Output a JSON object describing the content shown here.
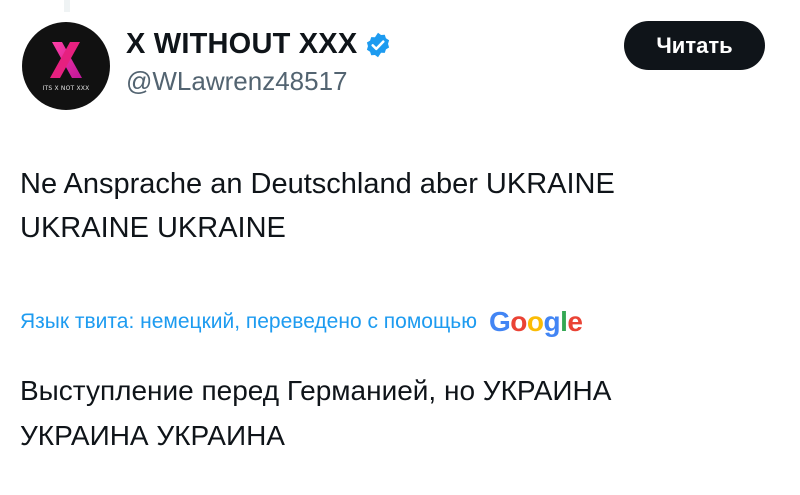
{
  "author": {
    "avatar_caption": "ITS X NOT XXX",
    "display_name": "X WITHOUT XXX",
    "handle": "@WLawrenz48517",
    "verified_icon": "verified-badge-icon"
  },
  "follow_button": {
    "label": "Читать"
  },
  "tweet": {
    "text_line1": "Ne Ansprache an Deutschland aber UKRAINE",
    "text_line2": "UKRAINE UKRAINE"
  },
  "translation": {
    "label": "Язык твита: немецкий, переведено с помощью",
    "provider_letters": [
      "G",
      "o",
      "o",
      "g",
      "l",
      "e"
    ],
    "text_line1": "Выступление перед Германией, но УКРАИНА",
    "text_line2": "УКРАИНА УКРАИНА"
  },
  "colors": {
    "accent": "#1d9bf0",
    "text": "#0f1419",
    "secondary": "#536471",
    "button_bg": "#0f1419",
    "google": [
      "#4285f4",
      "#ea4335",
      "#fbbc05",
      "#4285f4",
      "#34a853",
      "#ea4335"
    ]
  }
}
